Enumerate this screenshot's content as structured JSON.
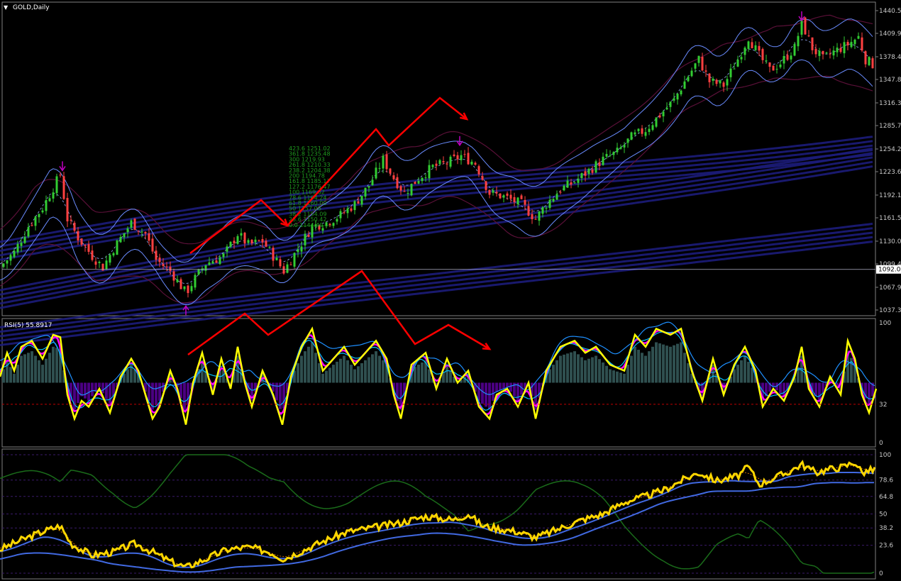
{
  "window": {
    "title": "GOLD,Daily"
  },
  "colors": {
    "background": "#000000",
    "frame": "#7f7f7f",
    "bull": "#32cd32",
    "bear": "#ff4040",
    "channel": "#1c1c7a",
    "bands": "#6a8cff",
    "envelope": "#5a1038",
    "arrows": "#ff0000",
    "rsi": "#ffff00",
    "rsi_hist_up": "#2f4f4f",
    "rsi_hist_down": "#4b0082",
    "stoch_main": "#ffd700",
    "stoch_green": "#1a6b1a",
    "stoch_blue": "#4169e1"
  },
  "chart_data": [
    {
      "type": "candlestick",
      "title": "GOLD,Daily",
      "ylim": [
        1037.3,
        1440.5
      ],
      "price_axis_ticks": [
        "1440.50",
        "1409.90",
        "1378.40",
        "1347.80",
        "1316.30",
        "1285.70",
        "1254.20",
        "1223.60",
        "1192.10",
        "1161.50",
        "1130.00",
        "1099.40",
        "1067.90",
        "1037.30"
      ],
      "current_price_label": "1092.00",
      "horizontal_line": 1092.0,
      "close_path": [
        [
          0,
          1095
        ],
        [
          20,
          1115
        ],
        [
          40,
          1150
        ],
        [
          60,
          1175
        ],
        [
          85,
          1220
        ],
        [
          95,
          1160
        ],
        [
          110,
          1135
        ],
        [
          130,
          1110
        ],
        [
          145,
          1095
        ],
        [
          160,
          1120
        ],
        [
          185,
          1155
        ],
        [
          205,
          1140
        ],
        [
          220,
          1105
        ],
        [
          240,
          1090
        ],
        [
          262,
          1060
        ],
        [
          275,
          1080
        ],
        [
          290,
          1100
        ],
        [
          315,
          1110
        ],
        [
          335,
          1140
        ],
        [
          350,
          1125
        ],
        [
          370,
          1130
        ],
        [
          385,
          1110
        ],
        [
          400,
          1090
        ],
        [
          420,
          1120
        ],
        [
          440,
          1150
        ],
        [
          460,
          1155
        ],
        [
          480,
          1165
        ],
        [
          500,
          1180
        ],
        [
          520,
          1205
        ],
        [
          540,
          1240
        ],
        [
          555,
          1215
        ],
        [
          570,
          1195
        ],
        [
          590,
          1215
        ],
        [
          610,
          1230
        ],
        [
          630,
          1235
        ],
        [
          650,
          1245
        ],
        [
          670,
          1235
        ],
        [
          690,
          1195
        ],
        [
          710,
          1190
        ],
        [
          735,
          1180
        ],
        [
          755,
          1160
        ],
        [
          770,
          1180
        ],
        [
          790,
          1200
        ],
        [
          810,
          1210
        ],
        [
          830,
          1225
        ],
        [
          850,
          1240
        ],
        [
          870,
          1250
        ],
        [
          890,
          1270
        ],
        [
          910,
          1280
        ],
        [
          930,
          1300
        ],
        [
          950,
          1320
        ],
        [
          965,
          1345
        ],
        [
          985,
          1375
        ],
        [
          1000,
          1345
        ],
        [
          1020,
          1340
        ],
        [
          1040,
          1375
        ],
        [
          1055,
          1405
        ],
        [
          1070,
          1380
        ],
        [
          1085,
          1360
        ],
        [
          1100,
          1370
        ],
        [
          1120,
          1390
        ],
        [
          1130,
          1425
        ],
        [
          1145,
          1390
        ],
        [
          1160,
          1375
        ],
        [
          1175,
          1385
        ],
        [
          1195,
          1395
        ],
        [
          1210,
          1405
        ],
        [
          1220,
          1375
        ],
        [
          1235,
          1365
        ]
      ],
      "pivot_markers": [
        {
          "x_bar": 88,
          "price": 1228,
          "direction": "down"
        },
        {
          "x_bar": 262,
          "price": 1040,
          "direction": "up"
        },
        {
          "x_bar": 648,
          "price": 1262,
          "direction": "down"
        },
        {
          "x_bar": 1130,
          "price": 1430,
          "direction": "down"
        }
      ],
      "fibonacci_levels": [
        {
          "ratio": "423.6",
          "price": "1251.02"
        },
        {
          "ratio": "361.8",
          "price": "1235.48"
        },
        {
          "ratio": "300",
          "price": "1219.93"
        },
        {
          "ratio": "261.8",
          "price": "1210.33"
        },
        {
          "ratio": "238.2",
          "price": "1204.38"
        },
        {
          "ratio": "200",
          "price": "1194.78"
        },
        {
          "ratio": "161.8",
          "price": "1185.17"
        },
        {
          "ratio": "127.2",
          "price": "1176.47"
        },
        {
          "ratio": "100",
          "price": "1169.62"
        },
        {
          "ratio": "78.6",
          "price": "1164.24"
        },
        {
          "ratio": "61.8",
          "price": "1160.00"
        },
        {
          "ratio": "50",
          "price": "1157.06"
        },
        {
          "ratio": "38.2",
          "price": "1154.09"
        },
        {
          "ratio": "23.6",
          "price": "1150.42"
        },
        {
          "ratio": "0.0",
          "price": "1144.49"
        }
      ]
    },
    {
      "type": "line",
      "title": "RSI(5) 55.8917",
      "ylim": [
        0,
        100
      ],
      "axis_ticks": [
        "100",
        "32",
        "0"
      ],
      "level_line": 32,
      "series": [
        {
          "name": "RSI(5)",
          "values": [
            [
              0,
              55
            ],
            [
              10,
              75
            ],
            [
              20,
              60
            ],
            [
              30,
              80
            ],
            [
              45,
              85
            ],
            [
              60,
              70
            ],
            [
              75,
              90
            ],
            [
              85,
              88
            ],
            [
              95,
              40
            ],
            [
              105,
              20
            ],
            [
              115,
              35
            ],
            [
              125,
              30
            ],
            [
              140,
              45
            ],
            [
              155,
              25
            ],
            [
              170,
              55
            ],
            [
              185,
              70
            ],
            [
              195,
              60
            ],
            [
              205,
              40
            ],
            [
              215,
              20
            ],
            [
              225,
              30
            ],
            [
              240,
              60
            ],
            [
              250,
              45
            ],
            [
              262,
              15
            ],
            [
              272,
              50
            ],
            [
              285,
              75
            ],
            [
              300,
              40
            ],
            [
              312,
              70
            ],
            [
              325,
              45
            ],
            [
              335,
              80
            ],
            [
              345,
              50
            ],
            [
              355,
              30
            ],
            [
              370,
              60
            ],
            [
              385,
              40
            ],
            [
              398,
              15
            ],
            [
              410,
              55
            ],
            [
              425,
              80
            ],
            [
              440,
              95
            ],
            [
              455,
              60
            ],
            [
              470,
              70
            ],
            [
              485,
              80
            ],
            [
              500,
              65
            ],
            [
              515,
              75
            ],
            [
              530,
              85
            ],
            [
              545,
              70
            ],
            [
              555,
              40
            ],
            [
              565,
              20
            ],
            [
              580,
              65
            ],
            [
              600,
              75
            ],
            [
              615,
              45
            ],
            [
              630,
              70
            ],
            [
              645,
              50
            ],
            [
              660,
              60
            ],
            [
              675,
              30
            ],
            [
              690,
              20
            ],
            [
              700,
              40
            ],
            [
              715,
              45
            ],
            [
              730,
              30
            ],
            [
              745,
              50
            ],
            [
              755,
              20
            ],
            [
              770,
              60
            ],
            [
              790,
              80
            ],
            [
              810,
              85
            ],
            [
              825,
              75
            ],
            [
              840,
              80
            ],
            [
              860,
              65
            ],
            [
              880,
              60
            ],
            [
              895,
              90
            ],
            [
              910,
              80
            ],
            [
              925,
              95
            ],
            [
              945,
              90
            ],
            [
              960,
              95
            ],
            [
              975,
              60
            ],
            [
              990,
              35
            ],
            [
              1005,
              70
            ],
            [
              1020,
              40
            ],
            [
              1035,
              65
            ],
            [
              1050,
              80
            ],
            [
              1065,
              60
            ],
            [
              1075,
              30
            ],
            [
              1090,
              45
            ],
            [
              1105,
              35
            ],
            [
              1120,
              55
            ],
            [
              1130,
              80
            ],
            [
              1140,
              45
            ],
            [
              1155,
              30
            ],
            [
              1170,
              55
            ],
            [
              1185,
              40
            ],
            [
              1195,
              85
            ],
            [
              1205,
              70
            ],
            [
              1215,
              40
            ],
            [
              1225,
              25
            ],
            [
              1235,
              45
            ]
          ]
        }
      ]
    },
    {
      "type": "line",
      "title": "",
      "ylim": [
        0,
        100
      ],
      "axis_ticks": [
        "100",
        "78.6",
        "64.8",
        "50",
        "38.2",
        "23.6",
        "0"
      ],
      "series": [
        {
          "name": "",
          "values": [
            [
              0,
              20
            ],
            [
              30,
              28
            ],
            [
              60,
              35
            ],
            [
              85,
              40
            ],
            [
              100,
              25
            ],
            [
              130,
              15
            ],
            [
              160,
              18
            ],
            [
              190,
              25
            ],
            [
              215,
              18
            ],
            [
              240,
              10
            ],
            [
              262,
              5
            ],
            [
              290,
              12
            ],
            [
              320,
              20
            ],
            [
              350,
              22
            ],
            [
              380,
              18
            ],
            [
              400,
              12
            ],
            [
              430,
              20
            ],
            [
              460,
              28
            ],
            [
              490,
              35
            ],
            [
              520,
              38
            ],
            [
              540,
              40
            ],
            [
              560,
              42
            ],
            [
              600,
              48
            ],
            [
              640,
              45
            ],
            [
              660,
              50
            ],
            [
              680,
              40
            ],
            [
              700,
              38
            ],
            [
              730,
              35
            ],
            [
              755,
              30
            ],
            [
              790,
              38
            ],
            [
              820,
              45
            ],
            [
              850,
              50
            ],
            [
              880,
              60
            ],
            [
              910,
              65
            ],
            [
              935,
              70
            ],
            [
              960,
              78
            ],
            [
              985,
              85
            ],
            [
              1010,
              78
            ],
            [
              1040,
              82
            ],
            [
              1055,
              90
            ],
            [
              1070,
              75
            ],
            [
              1090,
              80
            ],
            [
              1110,
              85
            ],
            [
              1130,
              92
            ],
            [
              1150,
              85
            ],
            [
              1170,
              88
            ],
            [
              1190,
              90
            ],
            [
              1205,
              94
            ],
            [
              1215,
              85
            ],
            [
              1235,
              88
            ]
          ]
        }
      ]
    }
  ]
}
